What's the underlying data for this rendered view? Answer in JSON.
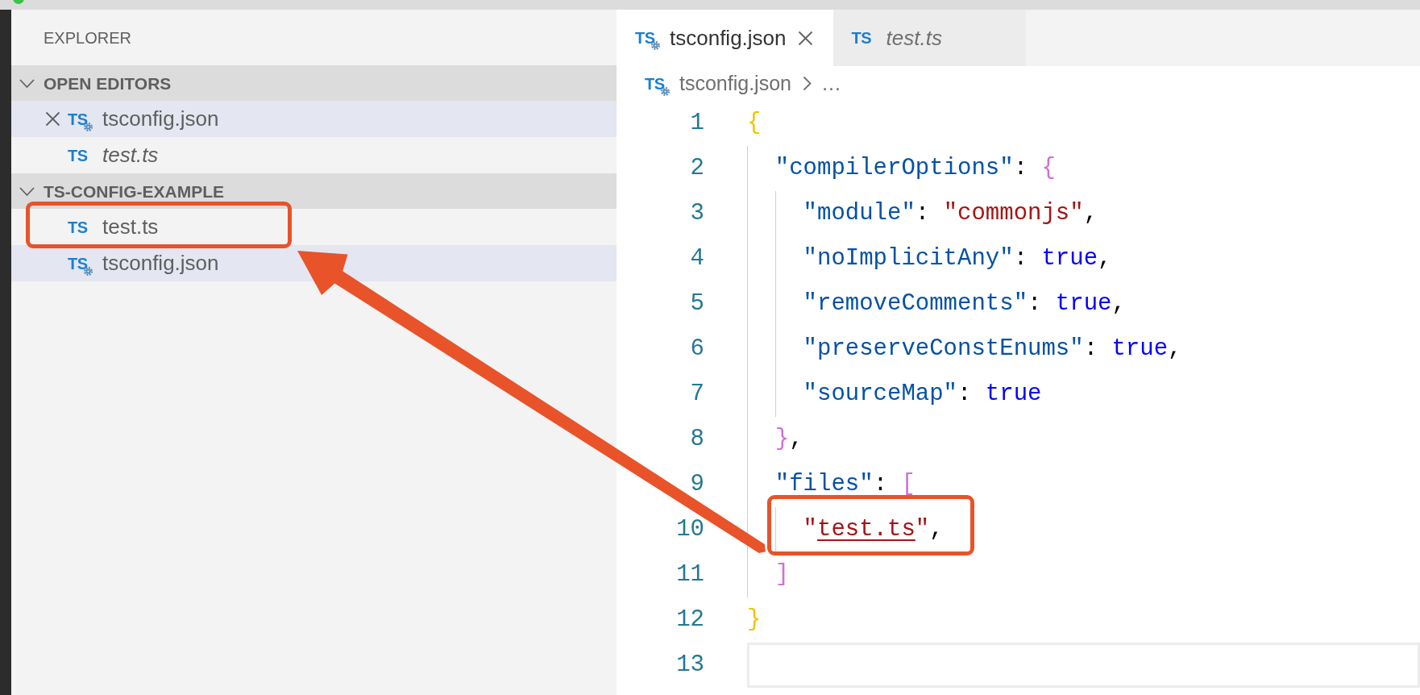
{
  "explorer": {
    "title": "EXPLORER",
    "sections": [
      {
        "title": "OPEN EDITORS",
        "expanded": true,
        "items": [
          {
            "kind": "config",
            "icon_label": "TS",
            "name": "tsconfig.json",
            "selected": true,
            "preview": false,
            "close_visible": true
          },
          {
            "kind": "ts",
            "icon_label": "TS",
            "name": "test.ts",
            "selected": false,
            "preview": true,
            "close_visible": false
          }
        ]
      },
      {
        "title": "TS-CONFIG-EXAMPLE",
        "expanded": true,
        "items": [
          {
            "kind": "ts",
            "icon_label": "TS",
            "name": "test.ts",
            "selected": false
          },
          {
            "kind": "config",
            "icon_label": "TS",
            "name": "tsconfig.json",
            "selected": true
          }
        ]
      }
    ]
  },
  "editor": {
    "tabs": [
      {
        "kind": "config",
        "icon_label": "TS",
        "label": "tsconfig.json",
        "selected": true,
        "preview": false
      },
      {
        "kind": "ts",
        "icon_label": "TS",
        "label": "test.ts",
        "selected": false,
        "preview": true
      }
    ],
    "breadcrumb": {
      "kind": "config",
      "icon_label": "TS",
      "path": [
        "tsconfig.json",
        "…"
      ]
    },
    "lines": [
      {
        "number": "1",
        "current": false,
        "tokens": [
          {
            "kind": "bracket",
            "text": "{"
          }
        ],
        "children": [
          {
            "number": "2",
            "current": false,
            "tokens": [
              {
                "kind": "key",
                "text": "\"compilerOptions\""
              },
              {
                "kind": "punct",
                "text": ": "
              },
              {
                "kind": "bracket",
                "text": "{"
              }
            ],
            "children": [
              {
                "number": "3",
                "current": false,
                "tokens": [
                  {
                    "kind": "key",
                    "text": "\"module\""
                  },
                  {
                    "kind": "punct",
                    "text": ": "
                  },
                  {
                    "kind": "string",
                    "text": "\"commonjs\""
                  },
                  {
                    "kind": "punct",
                    "text": ","
                  }
                ]
              },
              {
                "number": "4",
                "current": false,
                "tokens": [
                  {
                    "kind": "key",
                    "text": "\"noImplicitAny\""
                  },
                  {
                    "kind": "punct",
                    "text": ": "
                  },
                  {
                    "kind": "boolean",
                    "text": "true"
                  },
                  {
                    "kind": "punct",
                    "text": ","
                  }
                ]
              },
              {
                "number": "5",
                "current": false,
                "tokens": [
                  {
                    "kind": "key",
                    "text": "\"removeComments\""
                  },
                  {
                    "kind": "punct",
                    "text": ": "
                  },
                  {
                    "kind": "boolean",
                    "text": "true"
                  },
                  {
                    "kind": "punct",
                    "text": ","
                  }
                ]
              },
              {
                "number": "6",
                "current": false,
                "tokens": [
                  {
                    "kind": "key",
                    "text": "\"preserveConstEnums\""
                  },
                  {
                    "kind": "punct",
                    "text": ": "
                  },
                  {
                    "kind": "boolean",
                    "text": "true"
                  },
                  {
                    "kind": "punct",
                    "text": ","
                  }
                ]
              },
              {
                "number": "7",
                "current": false,
                "tokens": [
                  {
                    "kind": "key",
                    "text": "\"sourceMap\""
                  },
                  {
                    "kind": "punct",
                    "text": ": "
                  },
                  {
                    "kind": "boolean",
                    "text": "true"
                  }
                ]
              }
            ]
          },
          {
            "number": "8",
            "current": false,
            "tokens": [
              {
                "kind": "bracket",
                "text": "}"
              },
              {
                "kind": "punct",
                "text": ","
              }
            ]
          },
          {
            "number": "9",
            "current": false,
            "tokens": [
              {
                "kind": "key",
                "text": "\"files\""
              },
              {
                "kind": "punct",
                "text": ": "
              },
              {
                "kind": "bracket",
                "text": "["
              }
            ],
            "children": [
              {
                "number": "10",
                "current": false,
                "tokens": [
                  {
                    "kind": "string",
                    "text": "\""
                  },
                  {
                    "kind": "link",
                    "text": "test.ts"
                  },
                  {
                    "kind": "string",
                    "text": "\""
                  },
                  {
                    "kind": "punct",
                    "text": ","
                  }
                ]
              }
            ]
          },
          {
            "number": "11",
            "current": false,
            "tokens": [
              {
                "kind": "bracket",
                "text": "]"
              }
            ]
          }
        ]
      },
      {
        "number": "12",
        "current": false,
        "tokens": [
          {
            "kind": "bracket",
            "text": "}"
          }
        ]
      },
      {
        "number": "13",
        "current": true
      }
    ]
  }
}
